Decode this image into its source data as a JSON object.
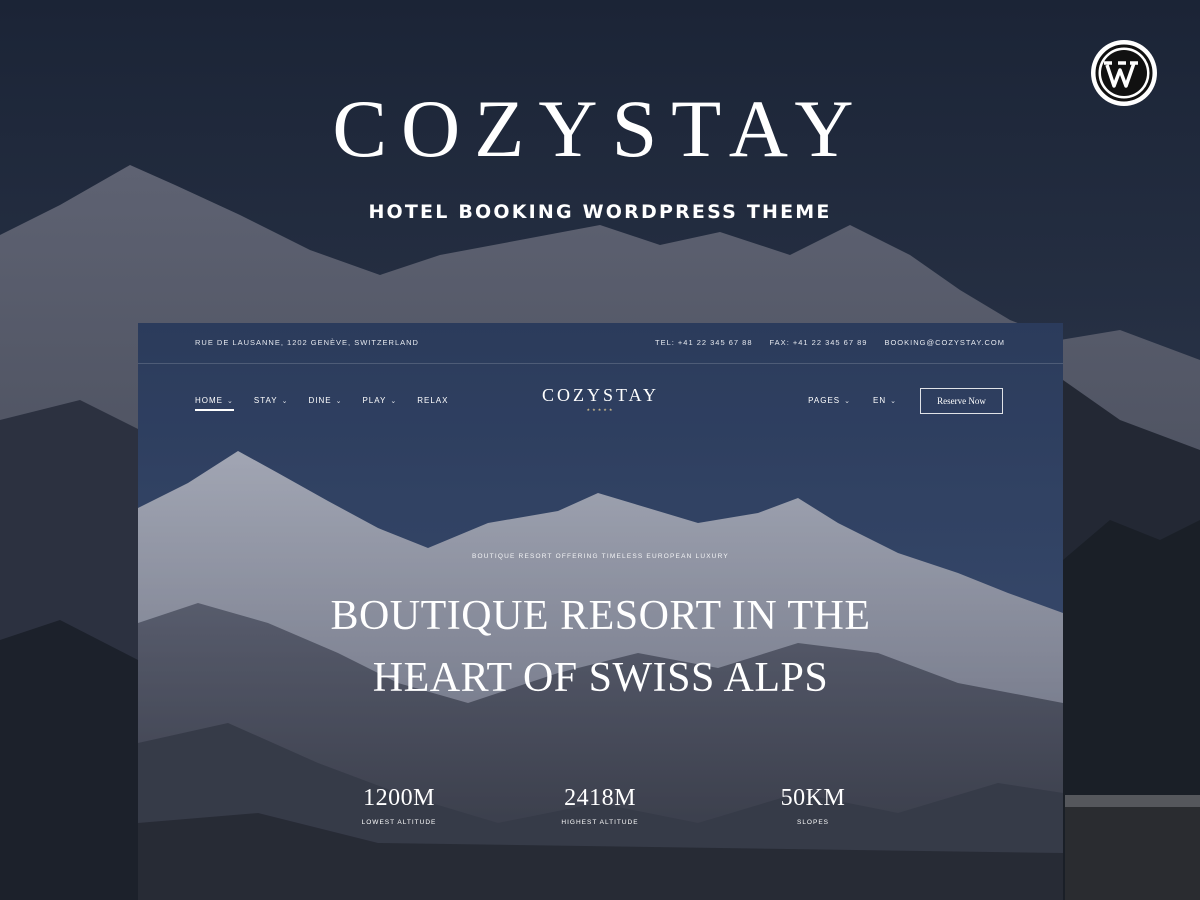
{
  "promo": {
    "brand": "COZYSTAY",
    "subtitle": "HOTEL BOOKING WORDPRESS THEME",
    "badge_icon": "wordpress-logo-icon"
  },
  "site": {
    "topbar": {
      "address": "RUE DE LAUSANNE, 1202 GENÈVE, SWITZERLAND",
      "tel": "TEL: +41 22 345 67 88",
      "fax": "FAX: +41 22 345 67 89",
      "email": "BOOKING@COZYSTAY.COM"
    },
    "nav": {
      "left": [
        {
          "label": "HOME",
          "active": true
        },
        {
          "label": "STAY"
        },
        {
          "label": "DINE"
        },
        {
          "label": "PLAY"
        },
        {
          "label": "RELAX"
        }
      ],
      "logo": "COZYSTAY",
      "stars": "★★★★★",
      "right": [
        {
          "label": "PAGES"
        },
        {
          "label": "EN"
        }
      ],
      "reserve_label": "Reserve Now",
      "chevron": "⌄"
    },
    "hero": {
      "eyebrow": "BOUTIQUE RESORT OFFERING TIMELESS EUROPEAN LUXURY",
      "title_line1": "BOUTIQUE RESORT IN THE",
      "title_line2": "HEART OF SWISS ALPS"
    },
    "stats": [
      {
        "value": "1200M",
        "label": "LOWEST ALTITUDE"
      },
      {
        "value": "2418M",
        "label": "HIGHEST ALTITUDE"
      },
      {
        "value": "50KM",
        "label": "SLOPES"
      }
    ]
  },
  "colors": {
    "page_bg": "#1a2230",
    "site_sky": "#34466a",
    "accent_gold": "#c9b88c"
  }
}
